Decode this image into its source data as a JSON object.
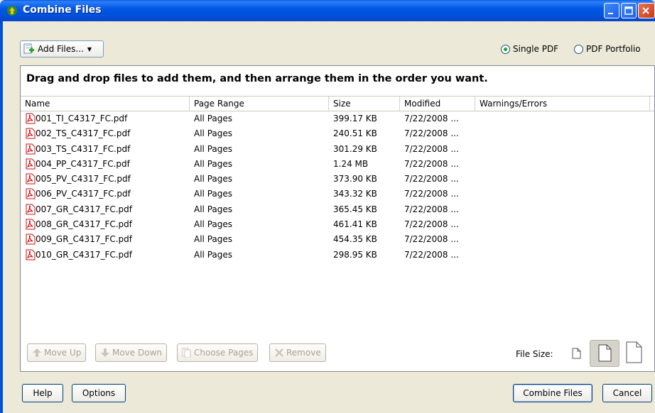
{
  "window": {
    "title": "Combine Files"
  },
  "toolbar": {
    "add_files_label": "Add Files...",
    "options": [
      {
        "label": "Single PDF",
        "selected": true
      },
      {
        "label": "PDF Portfolio",
        "selected": false
      }
    ]
  },
  "instructions": "Drag and drop files to add them, and then arrange them in the order you want.",
  "columns": [
    "Name",
    "Page Range",
    "Size",
    "Modified",
    "Warnings/Errors"
  ],
  "files": [
    {
      "name": "001_TI_C4317_FC.pdf",
      "range": "All Pages",
      "size": "399.17 KB",
      "modified": "7/22/2008 ..."
    },
    {
      "name": "002_TS_C4317_FC.pdf",
      "range": "All Pages",
      "size": "240.51 KB",
      "modified": "7/22/2008 ..."
    },
    {
      "name": "003_TS_C4317_FC.pdf",
      "range": "All Pages",
      "size": "301.29 KB",
      "modified": "7/22/2008 ..."
    },
    {
      "name": "004_PP_C4317_FC.pdf",
      "range": "All Pages",
      "size": "1.24 MB",
      "modified": "7/22/2008 ..."
    },
    {
      "name": "005_PV_C4317_FC.pdf",
      "range": "All Pages",
      "size": "373.90 KB",
      "modified": "7/22/2008 ..."
    },
    {
      "name": "006_PV_C4317_FC.pdf",
      "range": "All Pages",
      "size": "343.32 KB",
      "modified": "7/22/2008 ..."
    },
    {
      "name": "007_GR_C4317_FC.pdf",
      "range": "All Pages",
      "size": "365.45 KB",
      "modified": "7/22/2008 ..."
    },
    {
      "name": "008_GR_C4317_FC.pdf",
      "range": "All Pages",
      "size": "461.41 KB",
      "modified": "7/22/2008 ..."
    },
    {
      "name": "009_GR_C4317_FC.pdf",
      "range": "All Pages",
      "size": "454.35 KB",
      "modified": "7/22/2008 ..."
    },
    {
      "name": "010_GR_C4317_FC.pdf",
      "range": "All Pages",
      "size": "298.95 KB",
      "modified": "7/22/2008 ..."
    }
  ],
  "actions": {
    "move_up": "Move Up",
    "move_down": "Move Down",
    "choose_pages": "Choose Pages",
    "remove": "Remove"
  },
  "file_size_label": "File Size:",
  "footer": {
    "help": "Help",
    "options": "Options",
    "combine": "Combine Files",
    "cancel": "Cancel"
  },
  "colors": {
    "titlebar": "#0058E6",
    "dialog_bg": "#ECE9D8",
    "pdf_red": "#CC1010"
  }
}
